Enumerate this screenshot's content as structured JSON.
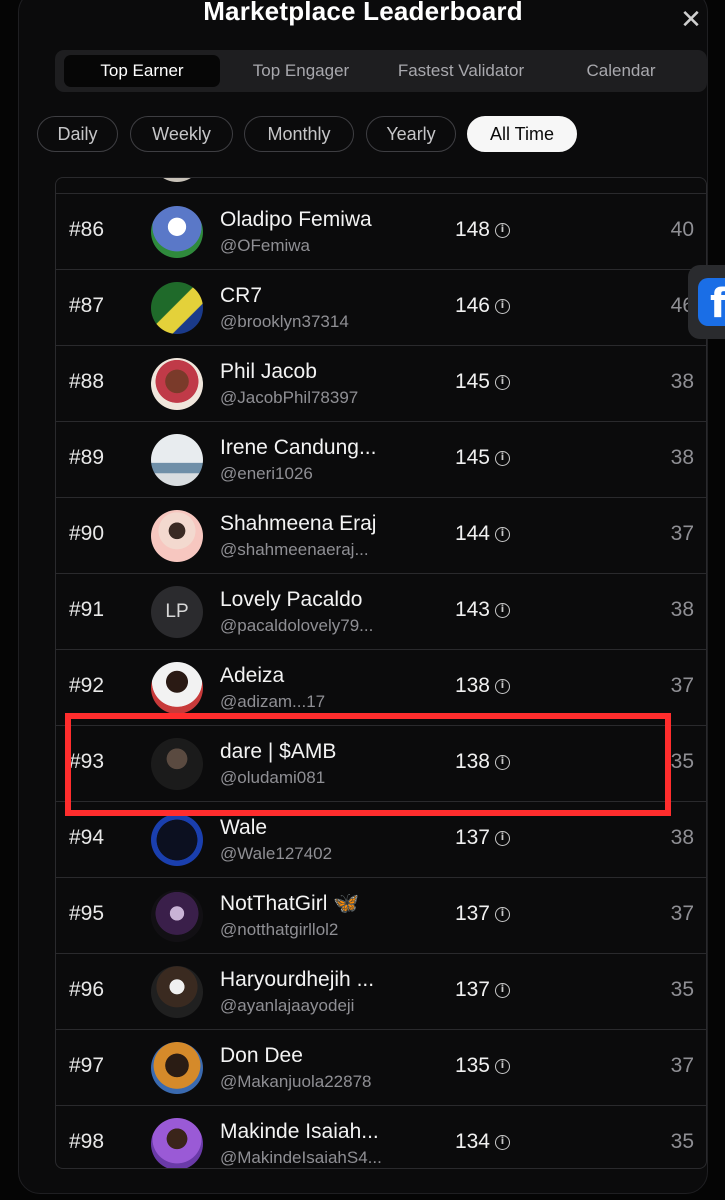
{
  "header": {
    "title": "Marketplace Leaderboard",
    "close_icon": "close-icon"
  },
  "tabs": [
    "Top Earner",
    "Top Engager",
    "Fastest Validator",
    "Calendar"
  ],
  "active_tab": "Top Earner",
  "periods": [
    "Daily",
    "Weekly",
    "Monthly",
    "Yearly",
    "All Time"
  ],
  "active_period": "All Time",
  "colors": {
    "highlight": "#ff2d2d",
    "background": "#0b0b0c",
    "facebook": "#1a6ee6"
  },
  "rows": [
    {
      "rank": "#86",
      "name": "Oladipo Femiwa",
      "handle": "@OFemiwa",
      "score": "148",
      "count": "40"
    },
    {
      "rank": "#87",
      "name": "CR7",
      "handle": "@brooklyn37314",
      "score": "146",
      "count": "46"
    },
    {
      "rank": "#88",
      "name": "Phil Jacob",
      "handle": "@JacobPhil78397",
      "score": "145",
      "count": "38"
    },
    {
      "rank": "#89",
      "name": "Irene Candung...",
      "handle": "@eneri1026",
      "score": "145",
      "count": "38"
    },
    {
      "rank": "#90",
      "name": "Shahmeena Eraj",
      "handle": "@shahmeenaeraj...",
      "score": "144",
      "count": "37"
    },
    {
      "rank": "#91",
      "name": "Lovely Pacaldo",
      "handle": "@pacaldolovely79...",
      "score": "143",
      "count": "38",
      "initials": "LP"
    },
    {
      "rank": "#92",
      "name": "Adeiza",
      "handle": "@adizam...17",
      "score": "138",
      "count": "37"
    },
    {
      "rank": "#93",
      "name": "dare | $AMB",
      "handle": "@oludami081",
      "score": "138",
      "count": "35"
    },
    {
      "rank": "#94",
      "name": "Wale",
      "handle": "@Wale127402",
      "score": "137",
      "count": "38"
    },
    {
      "rank": "#95",
      "name": "NotThatGirl 🦋",
      "handle": "@notthatgirllol2",
      "score": "137",
      "count": "37"
    },
    {
      "rank": "#96",
      "name": "Haryourdhejih ...",
      "handle": "@ayanlajaayodeji",
      "score": "137",
      "count": "35"
    },
    {
      "rank": "#97",
      "name": "Don Dee",
      "handle": "@Makanjuola22878",
      "score": "135",
      "count": "37"
    },
    {
      "rank": "#98",
      "name": "Makinde Isaiah...",
      "handle": "@MakindeIsaiahS4...",
      "score": "134",
      "count": "35"
    }
  ],
  "side_widget": {
    "label": "f",
    "icon": "facebook-icon"
  }
}
